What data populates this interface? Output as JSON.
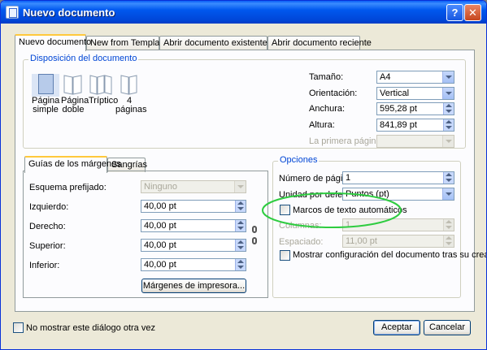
{
  "window": {
    "title": "Nuevo documento",
    "help_label": "?",
    "close_label": "✕",
    "icon": "document-icon"
  },
  "tabs": [
    "Nuevo documento",
    "New from Template",
    "Abrir documento existente",
    "Abrir documento reciente"
  ],
  "layout_group": {
    "title": "Disposición del documento",
    "items": [
      {
        "label": "Página simple",
        "icon": "single-page-icon"
      },
      {
        "label": "Página doble",
        "icon": "double-page-icon"
      },
      {
        "label": "Tríptico",
        "icon": "triptych-icon"
      },
      {
        "label": "4 páginas",
        "icon": "four-pages-icon"
      }
    ]
  },
  "page_settings": {
    "size_label": "Tamaño:",
    "size_value": "A4",
    "orientation_label": "Orientación:",
    "orientation_value": "Vertical",
    "width_label": "Anchura:",
    "width_value": "595,28 pt",
    "height_label": "Altura:",
    "height_value": "841,89 pt",
    "first_page_label": "La primera página es:",
    "first_page_value": ""
  },
  "margins": {
    "tabs": [
      "Guías de los márgenes",
      "Sangrías"
    ],
    "preset_label": "Esquema prefijado:",
    "preset_value": "Ninguno",
    "left_label": "Izquierdo:",
    "left_value": "40,00 pt",
    "right_label": "Derecho:",
    "right_value": "40,00 pt",
    "top_label": "Superior:",
    "top_value": "40,00 pt",
    "bottom_label": "Inferior:",
    "bottom_value": "40,00 pt",
    "printer_margins_button": "Márgenes de impresora...",
    "link_icon": "chain-link-icon"
  },
  "options": {
    "title": "Opciones",
    "pages_label": "Número de páginas:",
    "pages_value": "1",
    "unit_label": "Unidad por defecto:",
    "unit_value": "Puntos (pt)",
    "auto_frames_label": "Marcos de texto automáticos",
    "columns_label": "Columnas:",
    "columns_value": "1",
    "spacing_label": "Espaciado:",
    "spacing_value": "11,00 pt",
    "show_settings_label": "Mostrar configuración del documento tras su creación"
  },
  "footer": {
    "dont_show_label": "No mostrar este diálogo otra vez",
    "accept_label": "Aceptar",
    "cancel_label": "Cancelar"
  },
  "colors": {
    "title_bar": "#0054e3",
    "highlight_circle": "#2ecc40",
    "group_title": "#0046d5"
  }
}
